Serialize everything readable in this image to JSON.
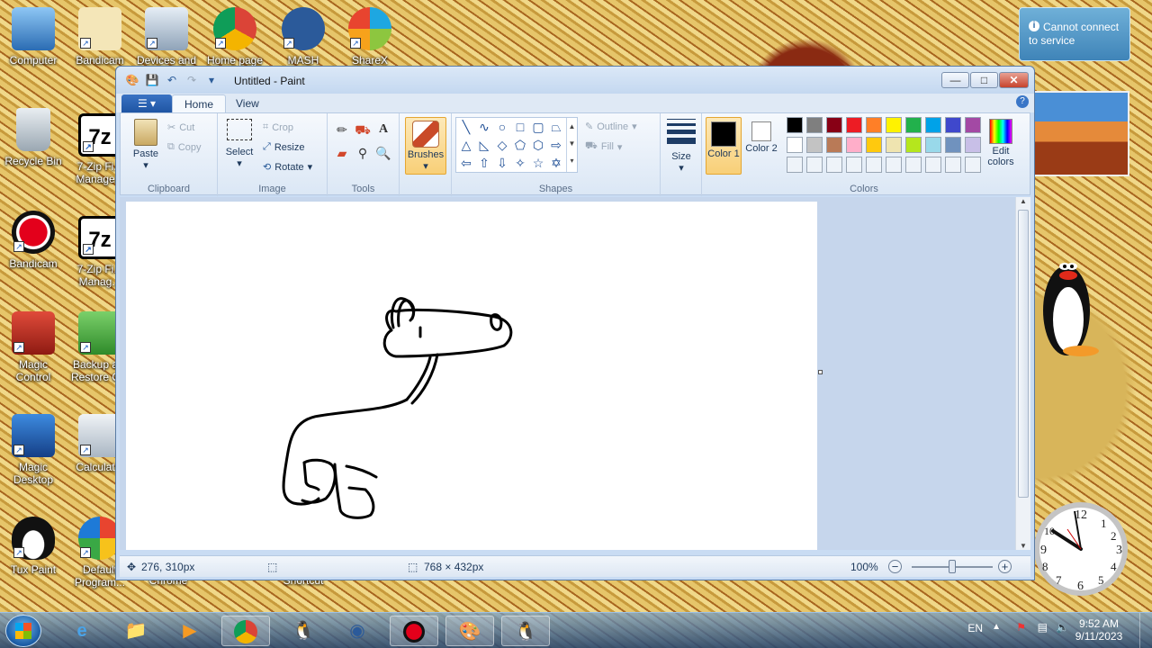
{
  "desktop": {
    "icons": [
      {
        "label": "Computer",
        "icon": "computer-icon"
      },
      {
        "label": "Bandicam",
        "icon": "bandicam-icon"
      },
      {
        "label": "Devices and ...",
        "icon": "devices-icon"
      },
      {
        "label": "Home page",
        "icon": "chrome-icon"
      },
      {
        "label": "MASH",
        "icon": "mash-icon"
      },
      {
        "label": "ShareX",
        "icon": "sharex-icon"
      },
      {
        "label": "Recycle Bin",
        "icon": "recycle-bin-icon"
      },
      {
        "label": "7-Zip Fi... Manage...",
        "icon": "7zip-icon"
      },
      {
        "label": "Bandicam",
        "icon": "bandicam-record-icon"
      },
      {
        "label": "7-Zip Fi... Manag...",
        "icon": "7zip-icon"
      },
      {
        "label": "Magic Control",
        "icon": "magic-control-icon"
      },
      {
        "label": "Backup a... Restore C...",
        "icon": "backup-icon"
      },
      {
        "label": "Magic Desktop",
        "icon": "magic-desktop-icon"
      },
      {
        "label": "Calculat...",
        "icon": "calculator-icon"
      },
      {
        "label": "Tux Paint",
        "icon": "tux-icon"
      },
      {
        "label": "Default Program...",
        "icon": "default-programs-icon"
      }
    ],
    "partial_labels": {
      "chrome": "Chrome",
      "shortcut": "Shortcut"
    },
    "notification": {
      "text": "Cannot connect to service"
    }
  },
  "paint": {
    "title": "Untitled - Paint",
    "tabs": {
      "file": "",
      "home": "Home",
      "view": "View"
    },
    "clipboard": {
      "paste": "Paste",
      "cut": "Cut",
      "copy": "Copy",
      "group": "Clipboard"
    },
    "image": {
      "select": "Select",
      "crop": "Crop",
      "resize": "Resize",
      "rotate": "Rotate",
      "group": "Image"
    },
    "tools": {
      "group": "Tools"
    },
    "brushes": {
      "label": "Brushes"
    },
    "shapes": {
      "group": "Shapes",
      "outline": "Outline",
      "fill": "Fill"
    },
    "size": {
      "label": "Size"
    },
    "colors": {
      "group": "Colors",
      "color1": "Color 1",
      "color2": "Color 2",
      "edit": "Edit colors",
      "color1_value": "#000000",
      "color2_value": "#ffffff",
      "palette_row1": [
        "#000000",
        "#7f7f7f",
        "#880015",
        "#ed1c24",
        "#ff7f27",
        "#fff200",
        "#22b14c",
        "#00a2e8",
        "#3f48cc",
        "#a349a4"
      ],
      "palette_row2": [
        "#ffffff",
        "#c3c3c3",
        "#b97a57",
        "#ffaec9",
        "#ffc90e",
        "#efe4b0",
        "#b5e61d",
        "#99d9ea",
        "#7092be",
        "#c8bfe7"
      ]
    },
    "status": {
      "cursor": "276, 310px",
      "canvas_size": "768 × 432px",
      "zoom": "100%",
      "zoom_fraction": 0.5
    }
  },
  "taskbar": {
    "language": "EN",
    "time": "9:52 AM",
    "date": "9/11/2023",
    "apps": [
      "ie-icon",
      "explorer-icon",
      "media-player-icon",
      "chrome-icon",
      "tux-icon",
      "mash-icon",
      "bandicam-icon",
      "paint-icon",
      "pingu-icon"
    ]
  }
}
